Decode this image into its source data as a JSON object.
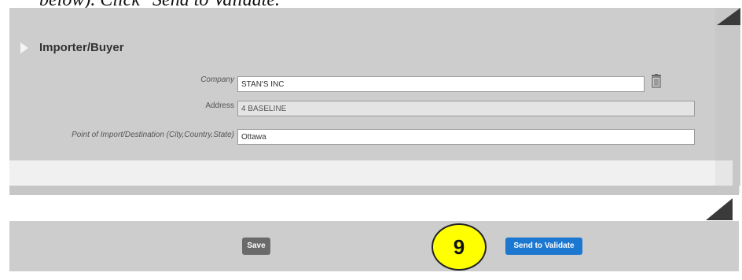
{
  "caption": "below). Click \"Send to Validate.\"",
  "section": {
    "title": "Importer/Buyer",
    "icon": "expand-triangle-icon"
  },
  "fields": {
    "company": {
      "label": "Company",
      "value": "STAN'S INC"
    },
    "address": {
      "label": "Address",
      "value": "4 BASELINE"
    },
    "destination": {
      "label": "Point of Import/Destination (City,Country,State)",
      "value": "Ottawa"
    }
  },
  "icons": {
    "trash": "trash-icon"
  },
  "buttons": {
    "save": "Save",
    "send": "Send to Validate"
  },
  "badge": "9",
  "colors": {
    "panel": "#cdcdcd",
    "send_button": "#1c77d1",
    "save_button": "#6a6a6a",
    "badge": "#ffff00"
  }
}
